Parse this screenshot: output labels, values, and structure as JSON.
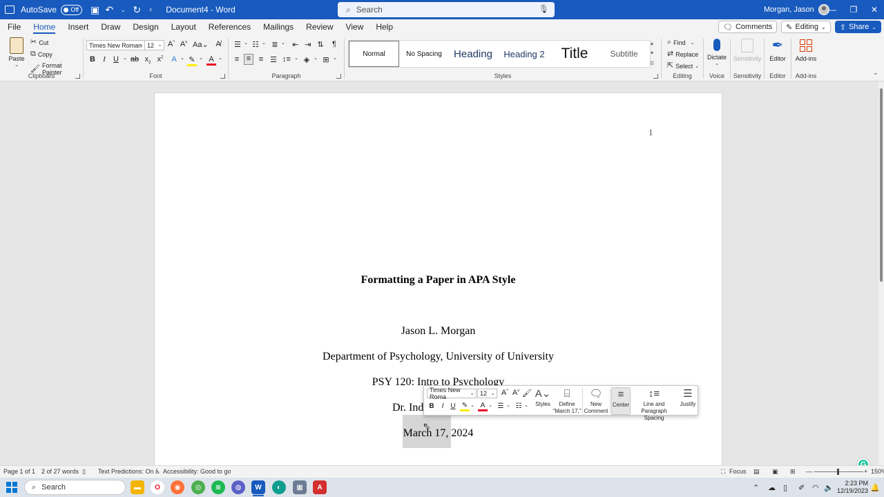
{
  "titlebar": {
    "autosave_label": "AutoSave",
    "autosave_state": "Off",
    "document_title": "Document4 - Word",
    "search_placeholder": "Search",
    "user_name": "Morgan, Jason"
  },
  "menu": {
    "tabs": [
      "File",
      "Home",
      "Insert",
      "Draw",
      "Design",
      "Layout",
      "References",
      "Mailings",
      "Review",
      "View",
      "Help"
    ],
    "active_tab": "Home",
    "comments_label": "Comments",
    "editing_label": "Editing",
    "share_label": "Share"
  },
  "ribbon": {
    "clipboard": {
      "label": "Clipboard",
      "paste": "Paste",
      "cut": "Cut",
      "copy": "Copy",
      "format_painter": "Format Painter"
    },
    "font": {
      "label": "Font",
      "font_name": "Times New Roman",
      "font_size": "12"
    },
    "paragraph": {
      "label": "Paragraph"
    },
    "styles": {
      "label": "Styles",
      "items": [
        "Normal",
        "No Spacing",
        "Heading",
        "Heading 2",
        "Title",
        "Subtitle"
      ]
    },
    "editing": {
      "label": "Editing",
      "find": "Find",
      "replace": "Replace",
      "select": "Select"
    },
    "voice": {
      "label": "Voice",
      "dictate": "Dictate"
    },
    "sensitivity": {
      "label": "Sensitivity",
      "button": "Sensitivity"
    },
    "editor": {
      "label": "Editor",
      "button": "Editor"
    },
    "addins": {
      "label": "Add-ins",
      "button": "Add-ins"
    }
  },
  "document": {
    "page_number": "1",
    "title": "Formatting a Paper in APA Style",
    "author": "Jason L. Morgan",
    "affiliation": "Department of Psychology, University of University",
    "course": "PSY 120: Intro to Psychology",
    "instructor_partial": "Dr. Ind",
    "date": "March 17, 2024"
  },
  "mini_toolbar": {
    "font_name": "Times New Roma",
    "font_size": "12",
    "styles": "Styles",
    "define_line1": "Define",
    "define_line2": "\"March 17,\"",
    "new_comment_line1": "New",
    "new_comment_line2": "Comment",
    "center": "Center",
    "line_spacing_line1": "Line and",
    "line_spacing_line2": "Paragraph Spacing",
    "justify": "Justify"
  },
  "statusbar": {
    "page": "Page 1 of 1",
    "words": "2 of 27 words",
    "text_predictions": "Text Predictions: On",
    "accessibility": "Accessibility: Good to go",
    "focus": "Focus",
    "zoom": "150%"
  },
  "taskbar": {
    "search_placeholder": "Search",
    "time": "2:23 PM",
    "date": "12/19/2023"
  },
  "colors": {
    "word_blue": "#185abd",
    "grammarly_green": "#15c39a",
    "font_color_red": "#e81123",
    "highlight_yellow": "#ffeb00"
  }
}
